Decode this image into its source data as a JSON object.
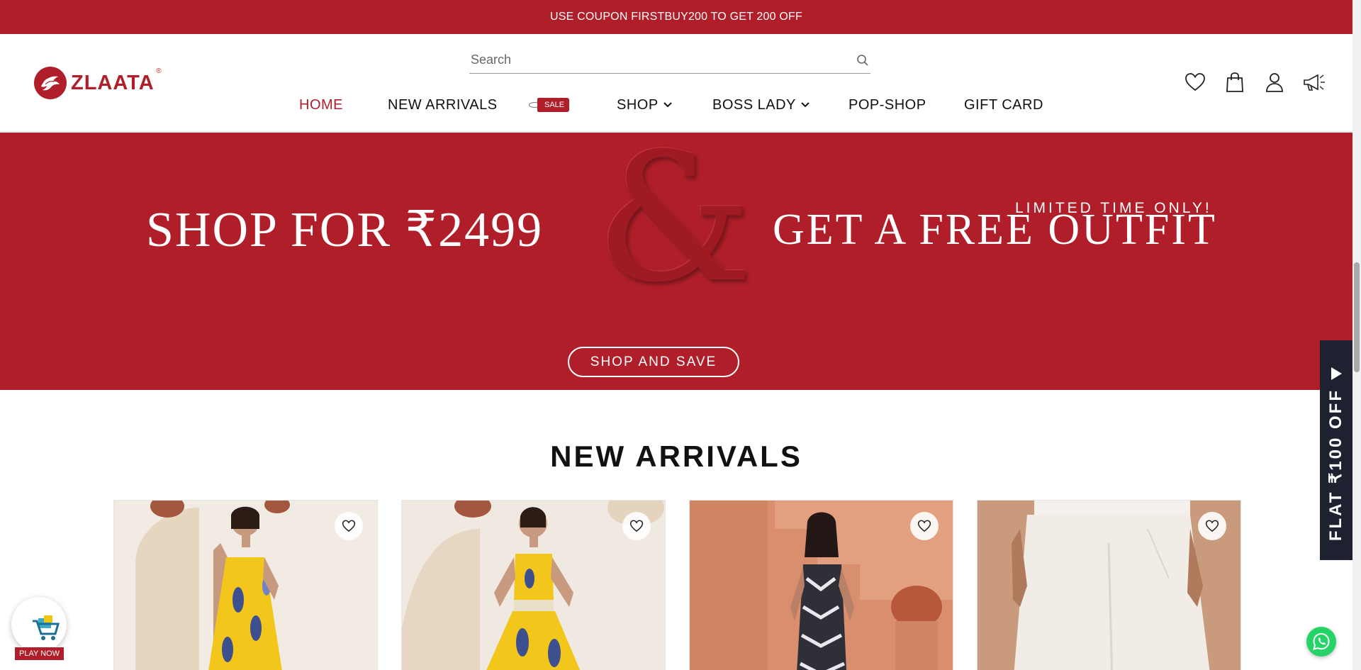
{
  "announcement": {
    "text": "USE COUPON FIRSTBUY200 TO GET 200 OFF"
  },
  "brand": {
    "name": "ZLAATA",
    "registered": "®",
    "color": "#b01f29"
  },
  "search": {
    "placeholder": "Search"
  },
  "nav": {
    "items": [
      {
        "label": "HOME",
        "active": true
      },
      {
        "label": "NEW ARRIVALS"
      },
      {
        "label": "SALE"
      },
      {
        "label": "SHOP",
        "dropdown": true
      },
      {
        "label": "BOSS LADY",
        "dropdown": true
      },
      {
        "label": "POP-SHOP"
      },
      {
        "label": "GIFT CARD"
      }
    ]
  },
  "header_icons": [
    "heart-icon",
    "shopping-bag-icon",
    "user-icon",
    "megaphone-icon"
  ],
  "hero": {
    "left_text": "SHOP FOR ₹2499",
    "ampersand": "&",
    "limited": "LIMITED TIME ONLY!",
    "right_text": "GET A FREE OUTFIT",
    "button": "SHOP AND SAVE",
    "background": "#b01f29"
  },
  "new_arrivals": {
    "title": "NEW ARRIVALS",
    "products": [
      {
        "style": "yellow-ikat-strappy-dress"
      },
      {
        "style": "yellow-ikat-co-ord-set"
      },
      {
        "style": "black-white-ikat-dress"
      },
      {
        "style": "white-trousers"
      }
    ]
  },
  "side_tab": {
    "text": "FLAT ₹100 OFF"
  },
  "play_widget": {
    "label": "PLAY NOW"
  }
}
